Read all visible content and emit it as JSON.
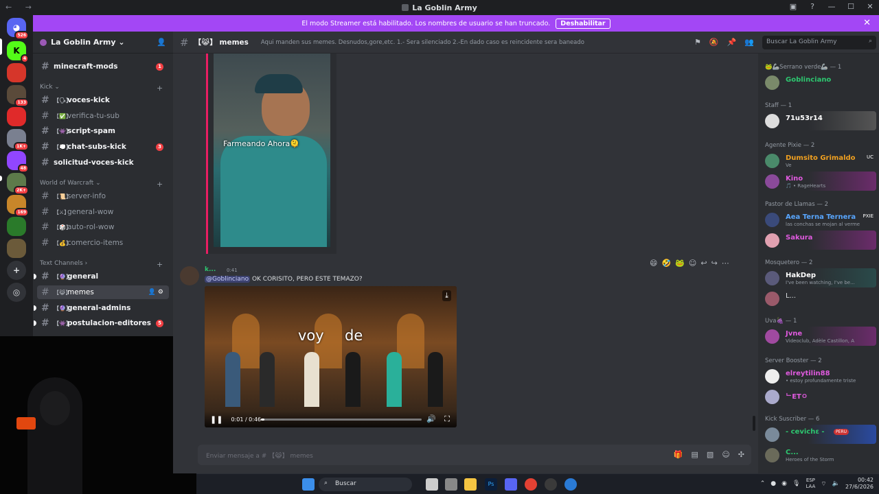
{
  "window": {
    "title": "La Goblin Army",
    "controls": [
      "▣",
      "?",
      "—",
      "☐",
      "✕"
    ]
  },
  "banner": {
    "text": "El modo Streamer está habilitado. Los nombres de usuario se han truncado.",
    "button": "Deshabilitar"
  },
  "rail": {
    "discord_badge": "526",
    "servers": [
      {
        "name": "K",
        "badge": "4"
      },
      {
        "name": "",
        "badge": "133"
      },
      {
        "name": "",
        "badge": ""
      },
      {
        "name": "",
        "badge": "1K+"
      },
      {
        "name": "",
        "badge": "48"
      },
      {
        "name": "",
        "badge": "2K+"
      },
      {
        "name": "",
        "badge": "169"
      },
      {
        "name": "",
        "badge": ""
      },
      {
        "name": "",
        "badge": ""
      }
    ]
  },
  "guild": {
    "name": "La Goblin Army"
  },
  "channels": {
    "minecraft_mods": {
      "name": "minecraft-mods",
      "count": "1"
    },
    "cat_kick": "Kick",
    "voces_kick": {
      "name": "voces-kick",
      "emoji": "【🗣】"
    },
    "verifica": {
      "name": "verifica-tu-sub",
      "emoji": "【✅】"
    },
    "script_spam": {
      "name": "script-spam",
      "emoji": "【👾】"
    },
    "chat_subs": {
      "name": "chat-subs-kick",
      "emoji": "【💭】",
      "count": "3"
    },
    "solicitud": {
      "name": "solicitud-voces-kick"
    },
    "cat_wow": "World of Warcraft",
    "server_info": {
      "name": "server-info",
      "emoji": "【📜】"
    },
    "general_wow": {
      "name": "general-wow",
      "emoji": "【⚔】"
    },
    "auto_rol": {
      "name": "auto-rol-wow",
      "emoji": "【🎲】"
    },
    "comercio": {
      "name": "comercio-items",
      "emoji": "【💰】"
    },
    "cat_text": "Text Channels",
    "general": {
      "name": "general",
      "emoji": "【🔮】"
    },
    "memes": {
      "name": "memes",
      "emoji": "【😹】"
    },
    "general_admins": {
      "name": "general-admins",
      "emoji": "【🔮】"
    },
    "postulacion": {
      "name": "postulacion-editores",
      "emoji": "【👾】",
      "count": "5"
    }
  },
  "header": {
    "channel": "memes",
    "emoji": "【😹】",
    "topic": "Aqui manden sus memes. Desnudos,gore,etc. 1.- Sera silenciado 2.-En dado caso es reincidente sera baneado"
  },
  "search": {
    "placeholder": "Buscar La Goblin Army"
  },
  "video1": {
    "caption": "Farmeando Ahora🫠"
  },
  "message": {
    "author": "k...",
    "time": "0:41",
    "mention": "@Goblinciano",
    "text": " OK CORISITO, PERO ESTE TEMAZO?",
    "video": {
      "caption_left": "voy",
      "caption_right": "de",
      "time": "0:01 / 0:46",
      "progress": 0.02
    }
  },
  "composer": {
    "placeholder": "Enviar mensaje a # 【😹】 memes"
  },
  "members": {
    "roles": [
      {
        "label": "🐸🦾Serrano verde🦾 — 1"
      },
      {
        "label": "Staff — 1"
      },
      {
        "label": "Agente Pixie — 2"
      },
      {
        "label": "Pastor de Llamas — 2"
      },
      {
        "label": "Mosquetero — 2"
      },
      {
        "label": "Uva🍇 — 1"
      },
      {
        "label": "Server Booster — 2"
      },
      {
        "label": "Kick Suscriber — 6"
      }
    ],
    "list": [
      {
        "name": "Goblinciano",
        "status": "",
        "color": "#2dc770"
      },
      {
        "name": "71u53r14",
        "status": "",
        "color": "#ffffff"
      },
      {
        "name": "Dumsito Grimaldo",
        "status": "Ve",
        "color": "#f0a020",
        "tag": "UC"
      },
      {
        "name": "Kino",
        "status": "🎵 • RageHearts",
        "color": "#e05adf"
      },
      {
        "name": "Aea Terna Ternera",
        "status": "las conchas se mojan al verme",
        "color": "#58a6ff",
        "tag": "PXIE"
      },
      {
        "name": "Sakura",
        "status": "",
        "color": "#e05adf"
      },
      {
        "name": "HakDep",
        "status": "I've been watching, I've be...",
        "color": "#ffffff"
      },
      {
        "name": "L...",
        "status": "",
        "color": "#ffffff"
      },
      {
        "name": "Jvne",
        "status": "Videoclub, Adèle Castillon, A",
        "color": "#e05adf"
      },
      {
        "name": "elreytilin88",
        "status": "• estoy profundamente triste",
        "color": "#e05adf"
      },
      {
        "name": "ᄂETㅇ",
        "status": "",
        "color": "#e05adf"
      },
      {
        "name": "- cevichε -",
        "status": "",
        "color": "#2dc770",
        "tag": "PERU"
      },
      {
        "name": "C...",
        "status": "Heroes of the Storm",
        "color": "#2dc770"
      }
    ]
  },
  "taskbar": {
    "search": "Buscar",
    "lang_top": "ESP",
    "lang_bottom": "LAA",
    "time": "00:42",
    "date": "27/6/2026"
  }
}
